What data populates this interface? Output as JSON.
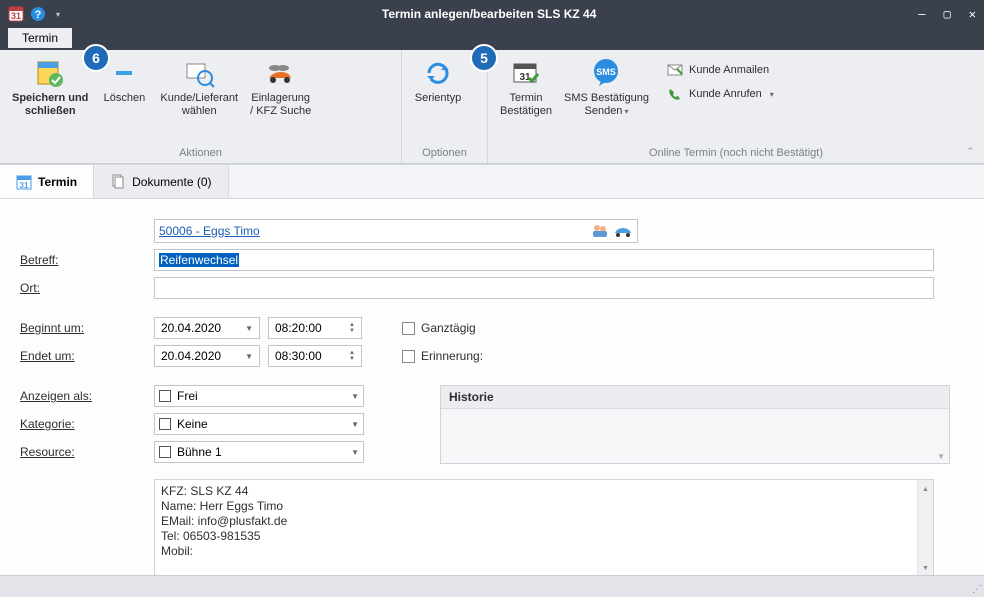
{
  "window": {
    "title": "Termin anlegen/bearbeiten SLS KZ 44"
  },
  "tabs": {
    "main": "Termin"
  },
  "ribbon": {
    "save_close": "Speichern und\nschließen",
    "delete": "Löschen",
    "pick_customer": "Kunde/Lieferant\nwählen",
    "storage": "Einlagerung\n/ KFZ Suche",
    "group_actions": "Aktionen",
    "series": "Serientyp",
    "group_options": "Optionen",
    "confirm": "Termin\nBestätigen",
    "sms": "SMS Bestätigung\nSenden",
    "mail": "Kunde Anmailen",
    "call": "Kunde Anrufen",
    "group_online": "Online Termin (noch nicht Bestätigt)"
  },
  "badges": {
    "five": "5",
    "six": "6"
  },
  "subtabs": {
    "termin": "Termin",
    "documents": "Dokumente (0)"
  },
  "form": {
    "customer_link": "50006 - Eggs Timo",
    "subject_label": "Betreff:",
    "subject_value": "Reifenwechsel",
    "location_label": "Ort:",
    "location_value": "",
    "start_label": "Beginnt um:",
    "start_date": "20.04.2020",
    "start_time": "08:20:00",
    "end_label": "Endet um:",
    "end_date": "20.04.2020",
    "end_time": "08:30:00",
    "allday": "Ganztägig",
    "reminder": "Erinnerung:",
    "showas_label": "Anzeigen als:",
    "showas_value": "Frei",
    "category_label": "Kategorie:",
    "category_value": "Keine",
    "resource_label": "Resource:",
    "resource_value": "Bühne 1",
    "history_label": "Historie",
    "notes": "KFZ: SLS KZ 44\nName: Herr Eggs Timo\nEMail: info@plusfakt.de\nTel: 06503-981535\nMobil:"
  }
}
